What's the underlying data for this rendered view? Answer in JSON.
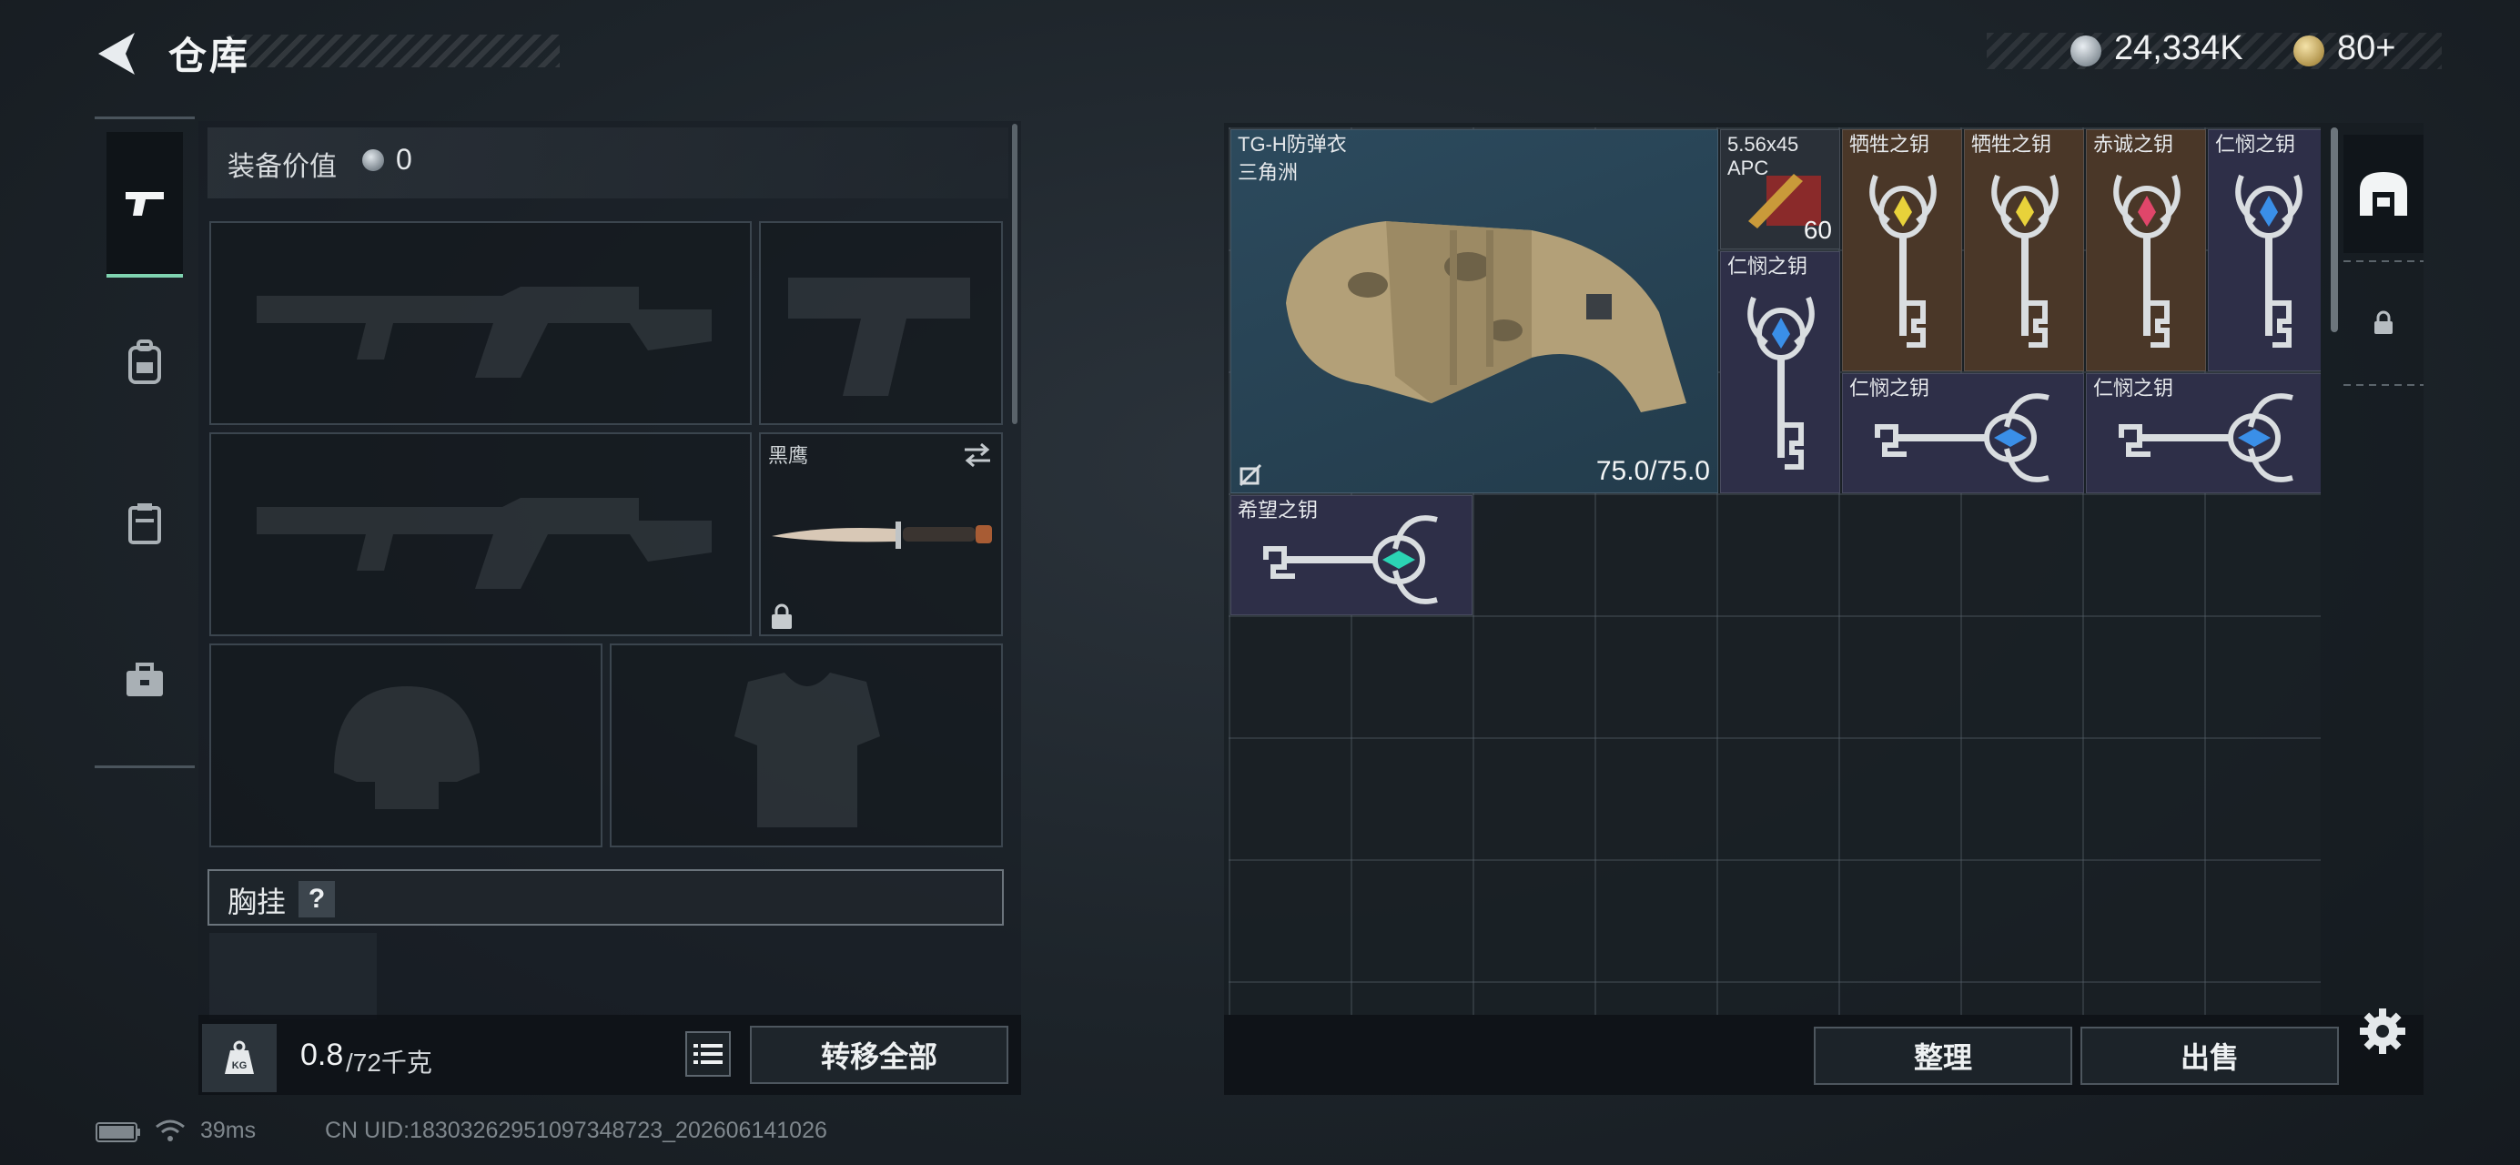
{
  "header": {
    "title": "仓库",
    "currency_silver": "24,334K",
    "currency_gold": "80+"
  },
  "tabs": [
    {
      "name": "weapons",
      "icon": "pistol-icon",
      "active": true
    },
    {
      "name": "gear",
      "icon": "backpack-icon",
      "active": false
    },
    {
      "name": "containers",
      "icon": "case-icon",
      "active": false
    },
    {
      "name": "supplies",
      "icon": "toolbox-icon",
      "active": false
    }
  ],
  "equipment": {
    "value_label": "装备价值",
    "value": "0",
    "melee_label": "黑鹰",
    "chest_rig_label": "胸挂",
    "help": "?"
  },
  "weight": {
    "current": "0.8",
    "max": "/72千克"
  },
  "buttons": {
    "transfer_all": "转移全部",
    "organize": "整理",
    "sell": "出售"
  },
  "storage": {
    "armor": {
      "name": "TG-H防弹衣",
      "sub": "三角洲",
      "durability": "75.0/75.0"
    },
    "ammo": {
      "name": "5.56x45",
      "sub": "APC",
      "count": "60"
    },
    "keys": [
      {
        "label": "牺牲之钥",
        "gem": "#e8d23a"
      },
      {
        "label": "牺牲之钥",
        "gem": "#e8d23a"
      },
      {
        "label": "赤诚之钥",
        "gem": "#e0466a"
      },
      {
        "label": "仁悯之钥",
        "gem": "#3a8fe8"
      },
      {
        "label": "仁悯之钥",
        "gem": "#3a8fe8"
      },
      {
        "label": "仁悯之钥",
        "gem": "#3a8fe8"
      },
      {
        "label": "仁悯之钥",
        "gem": "#3a8fe8"
      },
      {
        "label": "希望之钥",
        "gem": "#2bd4b4"
      }
    ]
  },
  "status_bar": {
    "ping": "39ms",
    "uid": "CN UID:18303262951097348723_202606141026"
  },
  "colors": {
    "accent": "#7fd3b0",
    "rarity_blue": "#2c4a5d",
    "rarity_purple": "#2e2f48",
    "rarity_orange": "#4a3728"
  }
}
